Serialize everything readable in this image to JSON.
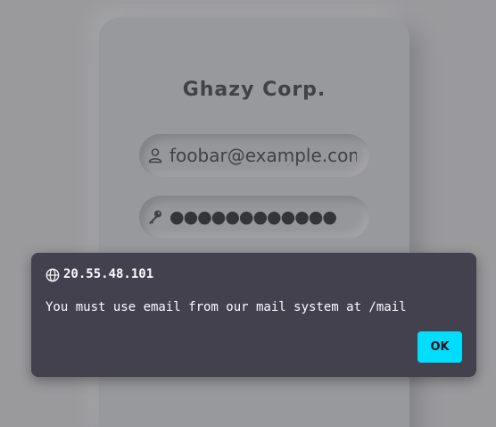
{
  "login": {
    "brand": "Ghazy Corp.",
    "username_value": "foobar@example.com",
    "password_value": "●●●●●●●●●●●●",
    "username_icon": "user-icon",
    "password_icon": "key-icon"
  },
  "dialog": {
    "origin_icon": "globe-icon",
    "origin": "20.55.48.101",
    "message": "You must use email from our mail system at /mail",
    "ok_label": "OK",
    "ok_color": "#00ddff",
    "background_color": "#42414d"
  }
}
